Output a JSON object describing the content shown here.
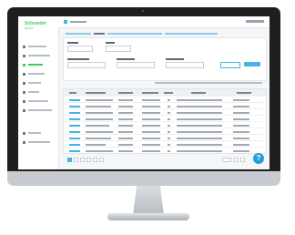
{
  "app": {
    "brand": "Schneider",
    "brand_sub": "Electric",
    "accent_color": "#42b4e6",
    "brand_color": "#3dcd58"
  },
  "sidebar": {
    "items": [
      {
        "icon": "overview-icon",
        "active": false
      },
      {
        "icon": "alarm-icon",
        "active": false
      },
      {
        "icon": "device-icon",
        "active": true
      },
      {
        "icon": "location-icon",
        "active": false
      },
      {
        "icon": "user-icon",
        "active": false
      },
      {
        "icon": "report-icon",
        "active": false
      },
      {
        "icon": "settings-icon",
        "active": false
      },
      {
        "icon": "data-icon",
        "active": false
      },
      {
        "icon": "help-icon",
        "active": false
      }
    ]
  },
  "help_button": {
    "label": "?"
  },
  "pagination": {
    "current_page": 1
  }
}
